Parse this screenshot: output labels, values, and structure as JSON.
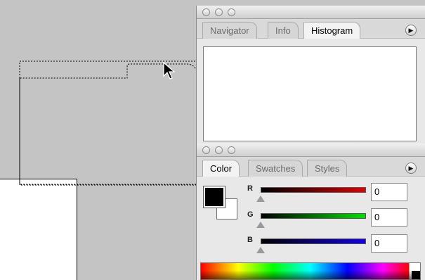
{
  "navigator_panel": {
    "tabs": [
      {
        "label": "Navigator",
        "active": false
      },
      {
        "label": "Info",
        "active": false
      },
      {
        "label": "Histogram",
        "active": true
      }
    ],
    "menu_glyph": "▶"
  },
  "color_panel": {
    "tabs": [
      {
        "label": "Color",
        "active": true
      },
      {
        "label": "Swatches",
        "active": false
      },
      {
        "label": "Styles",
        "active": false
      }
    ],
    "menu_glyph": "▶",
    "channels": [
      {
        "label": "R",
        "value": "0",
        "gradient_end": "#e30000"
      },
      {
        "label": "G",
        "value": "0",
        "gradient_end": "#00e000"
      },
      {
        "label": "B",
        "value": "0",
        "gradient_end": "#1400e6"
      }
    ],
    "foreground_color": "#000000",
    "background_color": "#ffffff"
  },
  "colors": {
    "canvas": "#c4c4c4",
    "panel": "#e8e8e8"
  }
}
